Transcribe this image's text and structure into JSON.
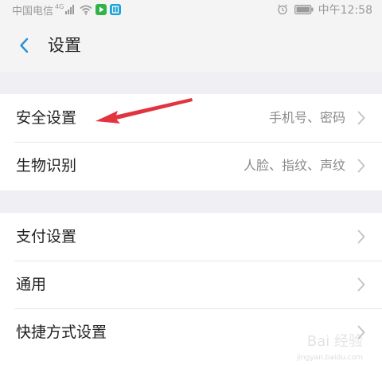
{
  "status_bar": {
    "carrier": "中国电信",
    "network_type": "4G",
    "time": "中午12:58"
  },
  "header": {
    "title": "设置"
  },
  "groups": [
    {
      "items": [
        {
          "label": "安全设置",
          "value": "手机号、密码"
        },
        {
          "label": "生物识别",
          "value": "人脸、指纹、声纹"
        }
      ]
    },
    {
      "items": [
        {
          "label": "支付设置",
          "value": ""
        },
        {
          "label": "通用",
          "value": ""
        },
        {
          "label": "快捷方式设置",
          "value": ""
        }
      ]
    }
  ],
  "watermark": {
    "text": "Bai 经验",
    "sub": "jingyan.baidu.com"
  },
  "colors": {
    "background": "#efeff4",
    "back_arrow": "#2a8fd6",
    "annotation_arrow": "#e2343f",
    "chevron": "#c2c2c2"
  }
}
